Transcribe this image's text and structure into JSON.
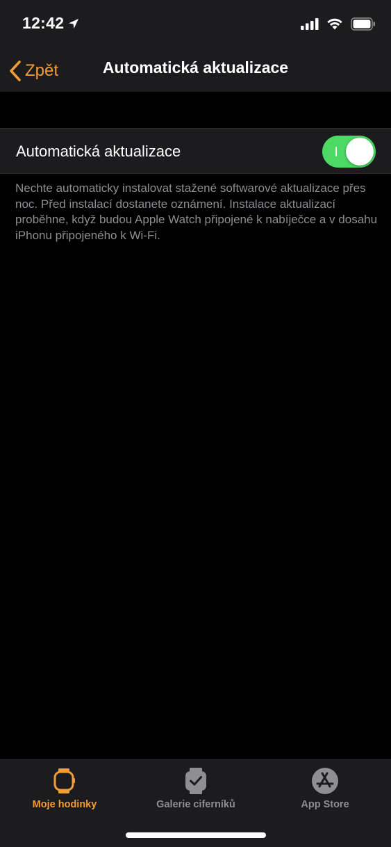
{
  "status_bar": {
    "time": "12:42"
  },
  "nav": {
    "back_label": "Zpět",
    "title": "Automatická aktualizace"
  },
  "settings": {
    "auto_update_label": "Automatická aktualizace",
    "auto_update_enabled": true,
    "footnote": "Nechte automaticky instalovat stažené softwarové aktualizace přes noc. Před instalací dostanete oznámení. Instalace aktualizací proběhne, když budou Apple Watch připojené k nabíječce a v dosahu iPhonu připojeného k Wi-Fi."
  },
  "tab_bar": {
    "tabs": [
      {
        "label": "Moje hodinky",
        "icon": "watch-icon",
        "active": true
      },
      {
        "label": "Galerie ciferníků",
        "icon": "watch-face-gallery-icon",
        "active": false
      },
      {
        "label": "App Store",
        "icon": "app-store-icon",
        "active": false
      }
    ]
  },
  "colors": {
    "accent": "#f29d38",
    "toggle_on": "#4cd964",
    "background": "#000000",
    "bar_background": "#1c1c1e",
    "secondary_text": "#8e8e93"
  }
}
